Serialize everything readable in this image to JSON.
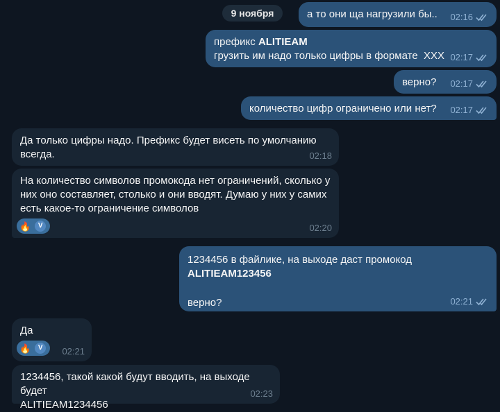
{
  "date_separator": "9 ноября",
  "messages": [
    {
      "text": "а то они ща нагрузили бы..",
      "time": "02:16"
    },
    {
      "line1_prefix": "префикс ",
      "line1_bold": "ALITIEAM",
      "line2": "грузить им надо только цифры в формате  XXX",
      "time": "02:17"
    },
    {
      "text": "верно?",
      "time": "02:17"
    },
    {
      "text": "количество цифр ограничено или нет?",
      "time": "02:17"
    },
    {
      "text": "Да только цифры надо. Префикс будет висеть по умолчанию\nвсегда.",
      "time": "02:18"
    },
    {
      "text": "На количество символов промокода нет ограничений, сколько у\nних оно составляет, столько и они вводят. Думаю у них у самих\nесть какое-то ограничение символов",
      "time": "02:20",
      "reaction_emoji": "🔥",
      "reaction_avatar": "V"
    },
    {
      "text_prefix": "1234456 в файлике, на выходе даст промокод  ",
      "text_bold": "ALITIEAM123456",
      "text2": "верно?",
      "time": "02:21"
    },
    {
      "text": "Да",
      "time": "02:21",
      "reaction_emoji": "🔥",
      "reaction_avatar": "V"
    },
    {
      "text": "1234456, такой какой будут вводить, на выходе будет\nALITIEAM1234456",
      "time": "02:23"
    }
  ],
  "colors": {
    "background": "#0e1621",
    "outgoing_bubble": "#2b5278",
    "incoming_bubble": "#182533",
    "reaction": "#3a6e9c"
  },
  "icons": {
    "read_status": "double-check-icon",
    "reaction": "fire-emoji"
  }
}
